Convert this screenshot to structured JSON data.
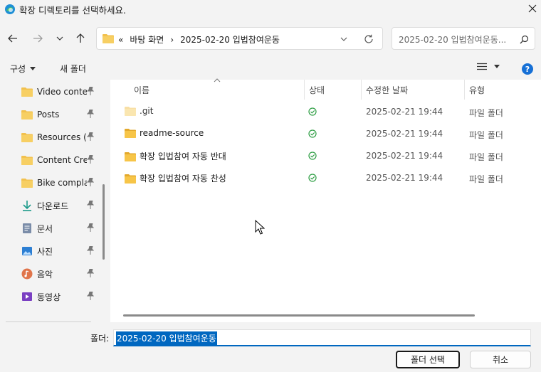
{
  "window": {
    "title": "확장 디렉토리를 선택하세요."
  },
  "nav": {
    "breadcrumb": [
      "«",
      "바탕 화면",
      "›",
      "2025-02-20 입법참여운동"
    ],
    "search_placeholder": "2025-02-20 입법참여운동..."
  },
  "toolbar": {
    "organize_label": "구성",
    "new_folder_label": "새 폴더"
  },
  "sidebar": {
    "items": [
      {
        "label": "Video content",
        "icon": "folder-icon"
      },
      {
        "label": "Posts",
        "icon": "folder-icon"
      },
      {
        "label": "Resources (p",
        "icon": "folder-icon"
      },
      {
        "label": "Content Crea",
        "icon": "folder-icon"
      },
      {
        "label": "Bike complai",
        "icon": "folder-icon"
      },
      {
        "label": "다운로드",
        "icon": "download-icon"
      },
      {
        "label": "문서",
        "icon": "document-icon"
      },
      {
        "label": "사진",
        "icon": "pictures-icon"
      },
      {
        "label": "음악",
        "icon": "music-icon"
      },
      {
        "label": "동영상",
        "icon": "video-icon"
      }
    ]
  },
  "table": {
    "columns": [
      "이름",
      "상태",
      "수정한 날짜",
      "유형"
    ],
    "rows": [
      {
        "name": ".git",
        "status": "synced",
        "date": "2025-02-21 19:44",
        "type": "파일 폴더",
        "faded": true
      },
      {
        "name": "readme-source",
        "status": "synced",
        "date": "2025-02-21 19:44",
        "type": "파일 폴더",
        "faded": false
      },
      {
        "name": "확장 입법참여 자동 반대",
        "status": "synced",
        "date": "2025-02-21 19:44",
        "type": "파일 폴더",
        "faded": false
      },
      {
        "name": "확장 입법참여 자동 찬성",
        "status": "synced",
        "date": "2025-02-21 19:44",
        "type": "파일 폴더",
        "faded": false
      }
    ]
  },
  "footer": {
    "folder_label": "폴더:",
    "folder_value": "2025-02-20 입법참여운동",
    "select_button": "폴더 선택",
    "cancel_button": "취소"
  },
  "colors": {
    "accent": "#0067c0",
    "folder": "#f2c14e",
    "synced": "#2e9e44"
  }
}
